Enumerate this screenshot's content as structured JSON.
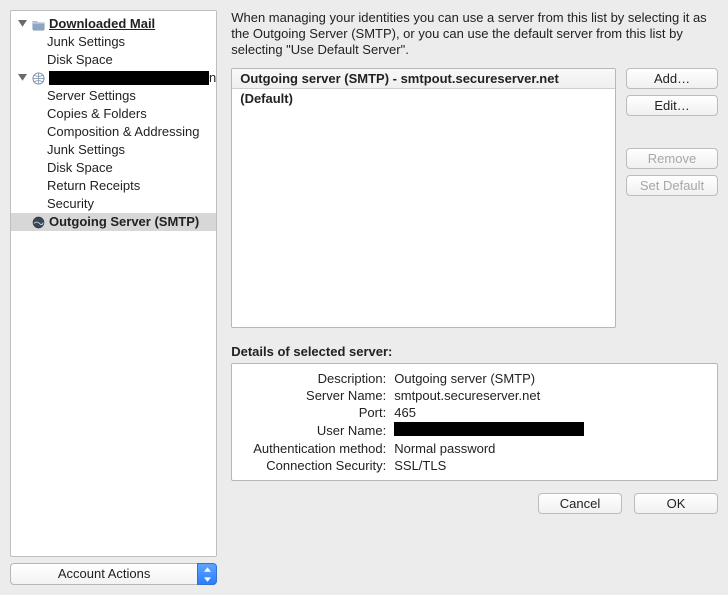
{
  "sidebar": {
    "tree": [
      {
        "icon": "folder-icon",
        "label": "Downloaded Mail",
        "disclosure": true,
        "style": "bold-underline"
      },
      {
        "indent": 1,
        "label": "Junk Settings"
      },
      {
        "indent": 1,
        "label": "Disk Space"
      },
      {
        "icon": "globe-icon",
        "redacted": true,
        "trailing": "n",
        "disclosure": true
      },
      {
        "indent": 1,
        "label": "Server Settings"
      },
      {
        "indent": 1,
        "label": "Copies & Folders"
      },
      {
        "indent": 1,
        "label": "Composition & Addressing"
      },
      {
        "indent": 1,
        "label": "Junk Settings"
      },
      {
        "indent": 1,
        "label": "Disk Space"
      },
      {
        "indent": 1,
        "label": "Return Receipts"
      },
      {
        "indent": 1,
        "label": "Security"
      },
      {
        "icon": "globe-dark-icon",
        "label": "Outgoing Server (SMTP)",
        "style": "bold",
        "selected": true
      }
    ],
    "account_actions": "Account Actions"
  },
  "main": {
    "intro": "When managing your identities you can use a server from this list by selecting it as the Outgoing Server (SMTP), or you can use the default server from this list by selecting \"Use Default Server\".",
    "server_list_header": "Outgoing server (SMTP) - smtpout.secureserver.net (Default)",
    "buttons": {
      "add": "Add…",
      "edit": "Edit…",
      "remove": "Remove",
      "set_default": "Set Default"
    },
    "details_title": "Details of selected server:",
    "details": [
      {
        "label": "Description:",
        "value": "Outgoing server (SMTP)"
      },
      {
        "label": "Server Name:",
        "value": "smtpout.secureserver.net"
      },
      {
        "label": "Port:",
        "value": "465"
      },
      {
        "label": "User Name:",
        "redacted": true
      },
      {
        "label": "Authentication method:",
        "value": "Normal password"
      },
      {
        "label": "Connection Security:",
        "value": "SSL/TLS"
      }
    ]
  },
  "footer": {
    "cancel": "Cancel",
    "ok": "OK"
  }
}
